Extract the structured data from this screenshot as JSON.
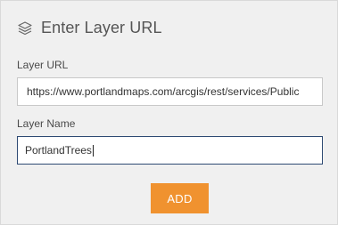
{
  "header": {
    "title": "Enter Layer URL",
    "icon": "layers-icon"
  },
  "form": {
    "url_label": "Layer URL",
    "url_value": "https://www.portlandmaps.com/arcgis/rest/services/Public",
    "name_label": "Layer Name",
    "name_value": "PortlandTrees"
  },
  "actions": {
    "add_label": "ADD"
  },
  "colors": {
    "panel_bg": "#f0f0f0",
    "button_bg": "#f0922f",
    "focused_border": "#2e4a73"
  }
}
